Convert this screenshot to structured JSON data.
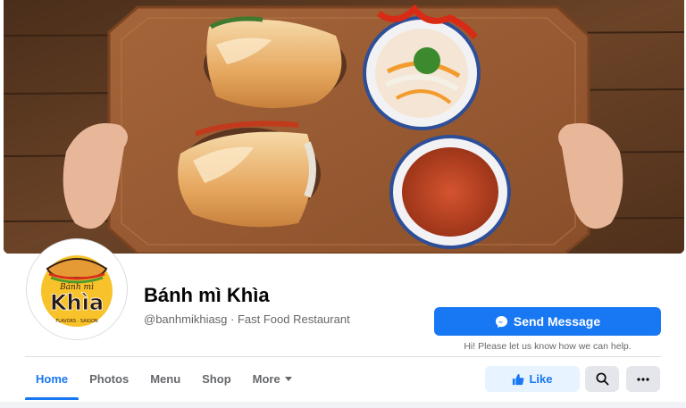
{
  "cover": {
    "alt_icon": "cover-photo"
  },
  "profile": {
    "logo_top_text": "Bánh mì",
    "logo_main_text": "Khìa",
    "logo_bottom_text": "FLAVORS · SAIGON"
  },
  "page": {
    "name": "Bánh mì Khìa",
    "subtitle": "@banhmikhiasg · Fast Food Restaurant"
  },
  "actions": {
    "send_message_label": "Send Message",
    "send_message_hint": "Hi! Please let us know how we can help.",
    "like_label": "Like"
  },
  "tabs": [
    {
      "label": "Home",
      "active": true
    },
    {
      "label": "Photos",
      "active": false
    },
    {
      "label": "Menu",
      "active": false
    },
    {
      "label": "Shop",
      "active": false
    },
    {
      "label": "More",
      "active": false
    }
  ],
  "colors": {
    "brand_blue": "#1877f2",
    "like_bg": "#e7f3ff",
    "secondary_bg": "#e4e6eb",
    "text_primary": "#050505",
    "text_secondary": "#65676b"
  }
}
